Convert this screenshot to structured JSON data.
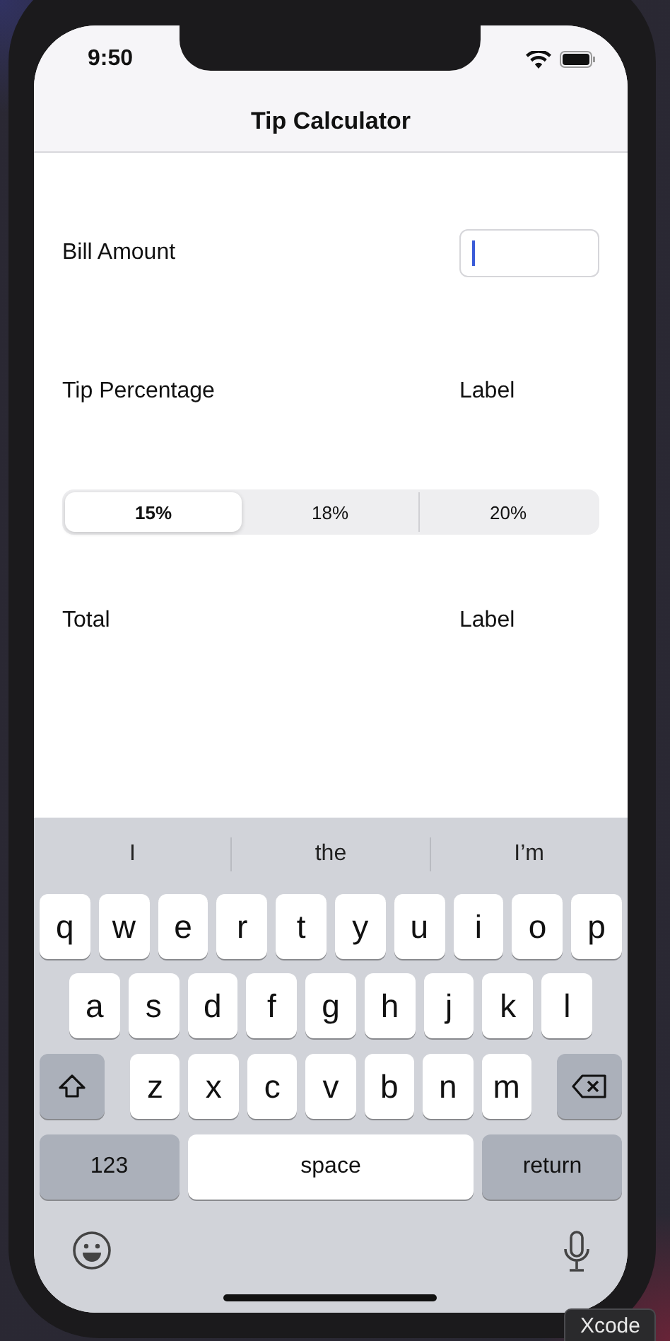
{
  "status_bar": {
    "time": "9:50"
  },
  "nav": {
    "title": "Tip Calculator"
  },
  "bill_amount": {
    "label": "Bill Amount",
    "focused": true
  },
  "tip_percentage": {
    "label": "Tip Percentage",
    "value": "Label"
  },
  "tip_options": [
    {
      "label": "15%",
      "selected": true
    },
    {
      "label": "18%",
      "selected": false
    },
    {
      "label": "20%",
      "selected": false
    }
  ],
  "total": {
    "label": "Total",
    "value": "Label"
  },
  "keyboard": {
    "suggestions": [
      "I",
      "the",
      "I’m"
    ],
    "rows": [
      [
        "q",
        "w",
        "e",
        "r",
        "t",
        "y",
        "u",
        "i",
        "o",
        "p"
      ],
      [
        "a",
        "s",
        "d",
        "f",
        "g",
        "h",
        "j",
        "k",
        "l"
      ],
      [
        "z",
        "x",
        "c",
        "v",
        "b",
        "n",
        "m"
      ]
    ],
    "bottom_keys": [
      "123",
      "space",
      "return"
    ]
  },
  "tooltip": "Xcode"
}
